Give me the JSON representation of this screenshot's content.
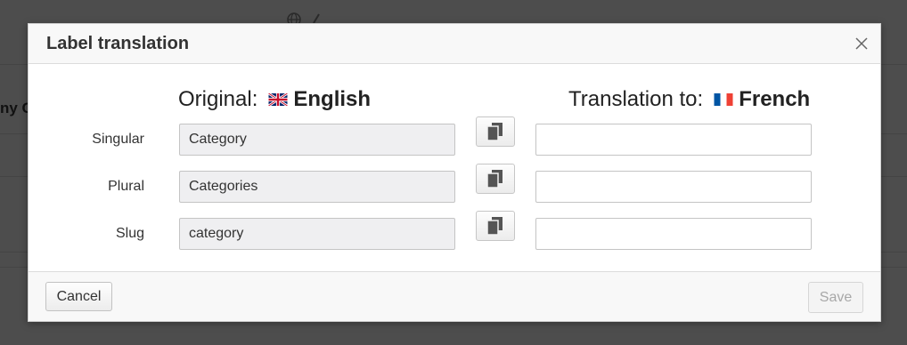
{
  "background": {
    "partial_text": "ny C"
  },
  "dialog": {
    "title": "Label translation",
    "original_prefix": "Original:",
    "original_language": "English",
    "translation_prefix": "Translation to:",
    "translation_language": "French",
    "rows": [
      {
        "label": "Singular",
        "original": "Category",
        "translation": ""
      },
      {
        "label": "Plural",
        "original": "Categories",
        "translation": ""
      },
      {
        "label": "Slug",
        "original": "category",
        "translation": ""
      }
    ],
    "cancel_label": "Cancel",
    "save_label": "Save",
    "icons": {
      "close": "close-icon",
      "copy": "copy-icon",
      "uk_flag": "uk-flag-icon",
      "fr_flag": "france-flag-icon"
    }
  },
  "colors": {
    "overlay": "#4a4a4a",
    "readonly_field": "#efeff1",
    "disabled_text": "#a8a8a8"
  }
}
